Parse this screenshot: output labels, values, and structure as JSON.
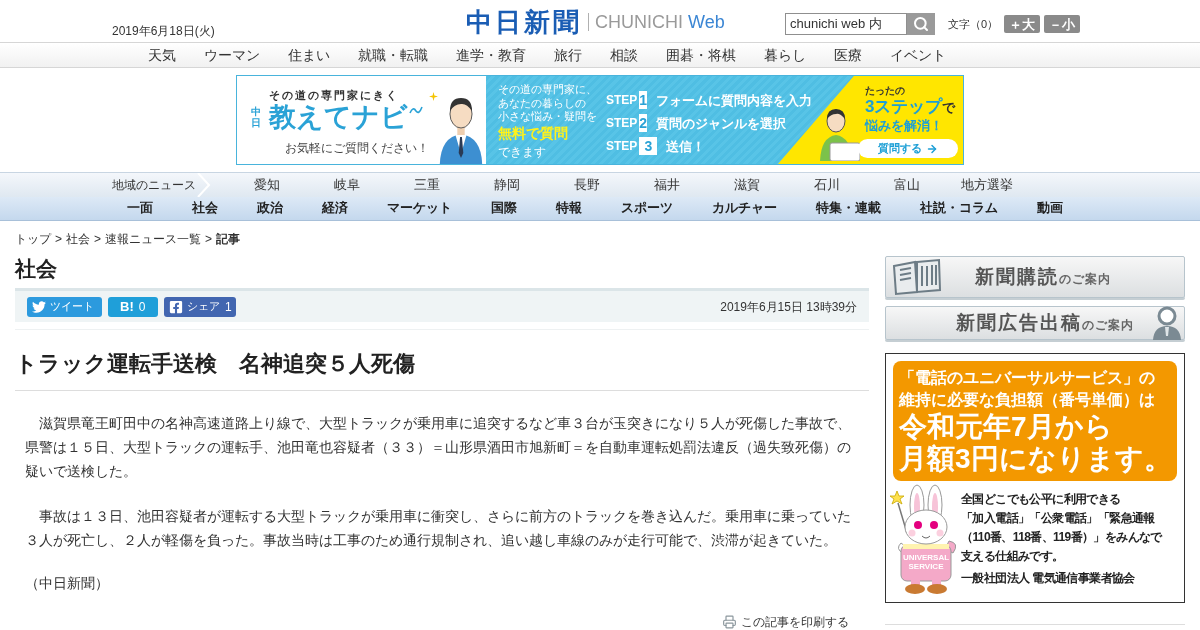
{
  "header": {
    "date": "2019年6月18日(火)",
    "logo": {
      "title": "中日新聞",
      "sub": "CHUNICHI",
      "sub_accent": "Web"
    },
    "search": {
      "value": "chunichi web 内"
    },
    "text_size": {
      "label": "文字（0）",
      "buttons": [
        "＋大",
        "－小"
      ]
    }
  },
  "service_nav": [
    "天気",
    "ウーマン",
    "住まい",
    "就職・転職",
    "進学・教育",
    "旅行",
    "相談",
    "囲碁・将棋",
    "暮らし",
    "医療",
    "イベント"
  ],
  "ad_banner": {
    "tagline": "その道の専門家にきく",
    "brand_small": "中日",
    "brand": "教えてナビ",
    "note": "お気軽にご質問ください！",
    "intro": [
      "その道の専門家に、",
      "あなたの暮らしの",
      "小さな悩み・疑問を"
    ],
    "highlight": "無料で質問",
    "intro_end": "できます",
    "steps": [
      {
        "label": "STEP",
        "number": "1",
        "text": "フォームに質問内容を入力"
      },
      {
        "label": "STEP",
        "number": "2",
        "text": "質問のジャンルを選択"
      },
      {
        "label": "STEP",
        "number": "3",
        "text": "送信！"
      }
    ],
    "promo": {
      "lead": "たったの",
      "accent": "3ステップ",
      "accent_suffix": "で",
      "result": "悩みを解消！",
      "button": "質問する"
    }
  },
  "region_nav": {
    "title": "地域のニュース",
    "items": [
      "愛知",
      "岐阜",
      "三重",
      "静岡",
      "長野",
      "福井",
      "滋賀",
      "石川",
      "富山",
      "地方選挙"
    ]
  },
  "category_nav": [
    "一面",
    "社会",
    "政治",
    "経済",
    "マーケット",
    "国際",
    "特報",
    "スポーツ",
    "カルチャー",
    "特集・連載",
    "社説・コラム",
    "動画"
  ],
  "breadcrumb": {
    "separator": ">",
    "items": [
      "トップ",
      "社会",
      "速報ニュース一覧",
      "記事"
    ]
  },
  "section_title": "社会",
  "share_bar": {
    "buttons": [
      {
        "kind": "twitter",
        "label": "ツイート"
      },
      {
        "kind": "hatena",
        "label": "B!",
        "count": "0"
      },
      {
        "kind": "facebook",
        "label": "シェア",
        "count": "1"
      }
    ],
    "timestamp": "2019年6月15日 13時39分"
  },
  "article": {
    "title": "トラック運転手送検　名神追突５人死傷",
    "paragraphs": [
      "滋賀県竜王町田中の名神高速道路上り線で、大型トラックが乗用車に追突するなど車３台が玉突きになり５人が死傷した事故で、県警は１５日、大型トラックの運転手、池田竜也容疑者（３３）＝山形県酒田市旭新町＝を自動車運転処罰法違反（過失致死傷）の疑いで送検した。",
      "事故は１３日、池田容疑者が運転する大型トラックが乗用車に衝突し、さらに前方のトラックを巻き込んだ。乗用車に乗っていた３人が死亡し、２人が軽傷を負った。事故当時は工事のため通行規制され、追い越し車線のみが走行可能で、渋滞が起きていた。"
    ],
    "source": "（中日新聞）",
    "print_link": "この記事を印刷する"
  },
  "sidebar": {
    "banners": [
      {
        "kind": "subscribe",
        "title": "新聞購読",
        "suffix": "のご案内"
      },
      {
        "kind": "advertise",
        "title": "新聞広告出稿",
        "suffix": "のご案内"
      }
    ],
    "ad": {
      "bubble_lines": [
        "「電話のユニバーサルサービス」の",
        "維持に必要な負担額（番号単価）は"
      ],
      "headline_lines": [
        "令和元年7月から",
        "月額3円になります。"
      ],
      "body_lines": [
        "全国どこでも公平に利用できる",
        "「加入電話」「公衆電話」「緊急通報",
        "（110番、118番、119番）」をみんなで",
        "支える仕組みです。"
      ],
      "mascot_label": "UNIVERSAL SERVICE",
      "sponsor": "一般社団法人 電気通信事業者協会"
    }
  }
}
